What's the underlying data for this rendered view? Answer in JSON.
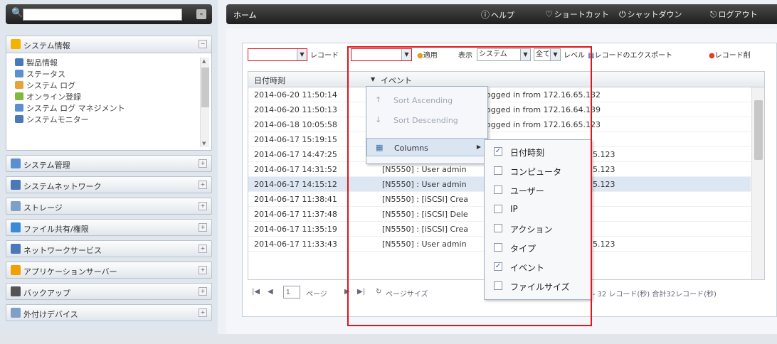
{
  "sidebar": {
    "search": {
      "value": "",
      "placeholder": ""
    },
    "open_section": {
      "label": "システム情報",
      "items": [
        {
          "label": "製品情報",
          "color": "#4a78b8"
        },
        {
          "label": "ステータス",
          "color": "#5a8fd0"
        },
        {
          "label": "システム ログ",
          "color": "#e6a23c"
        },
        {
          "label": "オンライン登録",
          "color": "#7fb83c"
        },
        {
          "label": "システム ログ マネジメント",
          "color": "#5a8fd0"
        },
        {
          "label": "システムモニター",
          "color": "#4a78b8"
        }
      ]
    },
    "sections": [
      {
        "label": "システム管理",
        "color": "#5a8fd0"
      },
      {
        "label": "システムネットワーク",
        "color": "#4a78b8"
      },
      {
        "label": "ストレージ",
        "color": "#7ea0c8"
      },
      {
        "label": "ファイル共有/権限",
        "color": "#3a8ad8"
      },
      {
        "label": "ネットワークサービス",
        "color": "#4a78b8"
      },
      {
        "label": "アプリケーションサーバー",
        "color": "#f0a000"
      },
      {
        "label": "バックアップ",
        "color": "#555555"
      },
      {
        "label": "外付けデバイス",
        "color": "#7ea0c8"
      }
    ]
  },
  "topbar": {
    "title": "ホーム",
    "help": "ヘルプ",
    "shortcut": "ショートカット",
    "shutdown": "シャットダウン",
    "logout": "ログアウト"
  },
  "toolbar": {
    "records_label": "レコード",
    "apply_label": "適用",
    "display_label": "表示",
    "type_value": "システム",
    "level_value": "全て",
    "level_label": "レベル",
    "export_label": "レコードのエクスポート",
    "records_delete_label": "レコード削"
  },
  "grid": {
    "columns": {
      "datetime": "日付時刻",
      "event": "イベント"
    },
    "rows": [
      {
        "datetime": "2014-06-20 11:50:14",
        "event": "",
        "tail": "ogged in from 172.16.65.132"
      },
      {
        "datetime": "2014-06-20 11:50:13",
        "event": "",
        "tail": "ogged in from 172.16.64.139"
      },
      {
        "datetime": "2014-06-18 10:05:58",
        "event": "",
        "tail": "ogged in from 172.16.65.123"
      },
      {
        "datetime": "2014-06-17 15:19:15",
        "event": "",
        "tail": ""
      },
      {
        "datetime": "2014-06-17 14:47:25",
        "event": "[N5550] : User admin",
        "tail": "5.123"
      },
      {
        "datetime": "2014-06-17 14:31:52",
        "event": "[N5550] : User admin",
        "tail": "5.123"
      },
      {
        "datetime": "2014-06-17 14:15:12",
        "event": "[N5550] : User admin",
        "tail": "5.123"
      },
      {
        "datetime": "2014-06-17 11:38:41",
        "event": "[N5550] : [iSCSI] Crea",
        "tail": ""
      },
      {
        "datetime": "2014-06-17 11:37:48",
        "event": "[N5550] : [iSCSI] Dele",
        "tail": ""
      },
      {
        "datetime": "2014-06-17 11:35:19",
        "event": "[N5550] : [iSCSI] Crea",
        "tail": ""
      },
      {
        "datetime": "2014-06-17 11:33:43",
        "event": "[N5550] : User admin",
        "tail": "5.123"
      }
    ]
  },
  "pager": {
    "page_value": "1",
    "page_label": "ページ",
    "page_size_label": "ページサイズ",
    "summary": "示 1 - 32 レコード(秒) 合計32レコード(秒)"
  },
  "context_menu": {
    "sort_asc": "Sort Ascending",
    "sort_desc": "Sort Descending",
    "columns": "Columns"
  },
  "columns_menu": [
    {
      "label": "日付時刻",
      "checked": true
    },
    {
      "label": "コンピュータ",
      "checked": false
    },
    {
      "label": "ユーザー",
      "checked": false
    },
    {
      "label": "IP",
      "checked": false
    },
    {
      "label": "アクション",
      "checked": false
    },
    {
      "label": "タイプ",
      "checked": false
    },
    {
      "label": "イベント",
      "checked": true
    },
    {
      "label": "ファイルサイズ",
      "checked": false
    }
  ]
}
